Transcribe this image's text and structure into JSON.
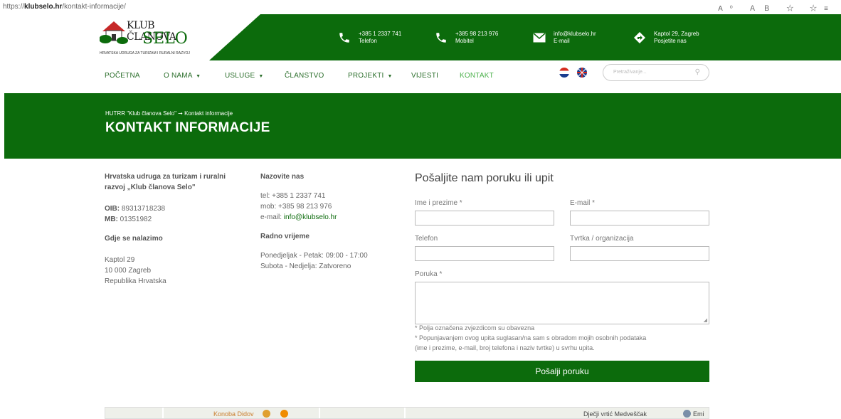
{
  "browser": {
    "url_prefix": "https://",
    "url_domain": "klubselo.hr",
    "url_path": "/kontakt-informacije/",
    "tools": "A⁰ ＡＢ ☆ ☆≡"
  },
  "logo": {
    "line1": "KLUB ČLANOVA",
    "line2": "SELO",
    "line3": "HRVATSKA UDRUGA ZA TURIZAM I RURALNI RAZVOJ"
  },
  "contacts": [
    {
      "icon": "phone-icon",
      "main": "+385 1 2337 741",
      "sub": "Telefon"
    },
    {
      "icon": "mobile-phone-icon",
      "main": "+385 98 213 976",
      "sub": "Mobitel"
    },
    {
      "icon": "envelope-icon",
      "main": "info@klubselo.hr",
      "sub": "E-mail"
    },
    {
      "icon": "directions-icon",
      "main": "Kaptol 29, Zagreb",
      "sub": "Posjetite nas"
    }
  ],
  "nav": {
    "items": [
      {
        "label": "POČETNA",
        "caret": ""
      },
      {
        "label": "O NAMA",
        "caret": "▼"
      },
      {
        "label": "USLUGE",
        "caret": "▼"
      },
      {
        "label": "ČLANSTVO",
        "caret": ""
      },
      {
        "label": "PROJEKTI",
        "caret": "▼"
      },
      {
        "label": "VIJESTI",
        "caret": ""
      },
      {
        "label": "KONTAKT",
        "caret": ""
      }
    ],
    "search_placeholder": "Pretraživanje..."
  },
  "hero": {
    "breadcrumb": "HUTRR \"Klub članova Selo\" ➞ Kontakt informacije",
    "title": "KONTAKT INFORMACIJE"
  },
  "org": {
    "name": "Hrvatska udruga za turizam i ruralni razvoj „Klub članova Selo\"",
    "oib_label": "OIB:",
    "oib": "89313718238",
    "mb_label": "MB:",
    "mb": "01351982",
    "location_heading": "Gdje se nalazimo",
    "address1": "Kaptol 29",
    "address2": "10 000 Zagreb",
    "address3": "Republika Hrvatska"
  },
  "call": {
    "heading": "Nazovite nas",
    "tel": "tel: +385 1 2337 741",
    "mob": "mob: +385 98 213 976",
    "email_label": "e-mail:",
    "email": "info@klubselo.hr",
    "hours_heading": "Radno vrijeme",
    "hours1": "Ponedjeljak - Petak: 09:00 - 17:00",
    "hours2": "Subota - Nedjelja: Zatvoreno"
  },
  "form": {
    "title": "Pošaljite nam poruku ili upit",
    "name_label": "Ime i prezime *",
    "email_label": "E-mail *",
    "phone_label": "Telefon",
    "company_label": "Tvrtka / organizacija",
    "message_label": "Poruka *",
    "note1": "* Polja označena zvjezdicom su obavezna",
    "note2": "* Popunjavanjem ovog upita suglasan/na sam s obradom mojih osobnih podataka",
    "note3": "(ime i prezime, e-mail, broj telefona i naziv tvrtke) u svrhu upita.",
    "submit": "Pošalji poruku"
  },
  "map": {
    "label1": "Konoba Didov",
    "label2": "Dječji vrtić Medveščak",
    "label3": "Emi"
  }
}
